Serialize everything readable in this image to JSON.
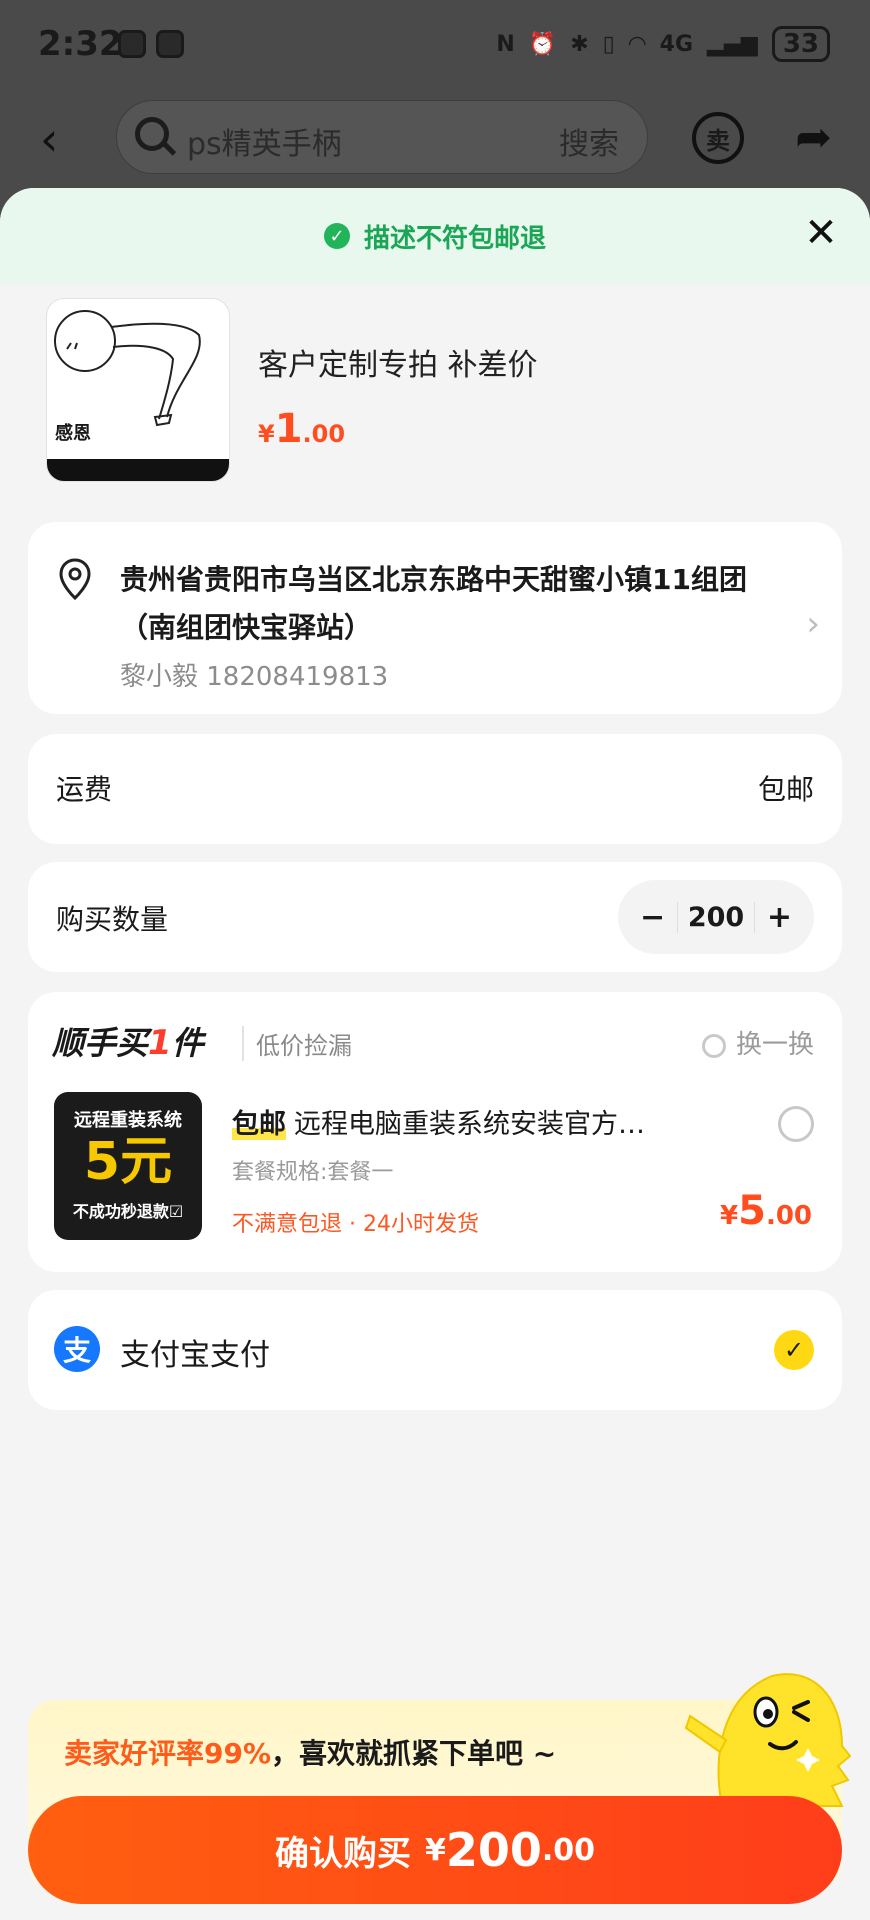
{
  "status_bar": {
    "time": "2:32",
    "network": "4G",
    "battery": "33"
  },
  "topbar": {
    "search_placeholder": "ps精英手柄",
    "search_button": "搜索",
    "sell_icon_label": "卖"
  },
  "sheet": {
    "banner": "描述不符包邮退",
    "product": {
      "image_caption": "感恩",
      "title": "客户定制专拍 补差价",
      "price_symbol": "¥",
      "price_int": "1",
      "price_dec": ".00"
    },
    "address": {
      "line": "贵州省贵阳市乌当区北京东路中天甜蜜小镇11组团（南组团快宝驿站）",
      "contact": "黎小毅 18208419813"
    },
    "shipping": {
      "label": "运费",
      "value": "包邮"
    },
    "quantity": {
      "label": "购买数量",
      "minus": "−",
      "value": "200",
      "plus": "+"
    },
    "upsell": {
      "heading_prefix": "顺手买",
      "heading_num": "1",
      "heading_suffix": "件",
      "subtitle": "低价捡漏",
      "swap": "换一换",
      "thumb_line1": "远程重装系统",
      "thumb_line2": "5元",
      "thumb_line3": "不成功秒退款☑",
      "tag": "包邮",
      "title": "远程电脑重装系统安装官方…",
      "spec": "套餐规格:套餐一",
      "note": "不满意包退 · 24小时发货",
      "price_symbol": "¥",
      "price_int": "5",
      "price_dec": ".00"
    },
    "payment": {
      "logo": "支",
      "label": "支付宝支付"
    },
    "promo": {
      "highlight": "卖家好评率99%",
      "text": "，喜欢就抓紧下单吧 ~"
    },
    "buy": {
      "label": "确认购买",
      "price_symbol": "¥",
      "price_int": "200",
      "price_dec": ".00"
    }
  },
  "colors": {
    "accent": "#ff4d1f",
    "green": "#21b45a",
    "yellow": "#ffd814",
    "alipay": "#1677ff"
  }
}
